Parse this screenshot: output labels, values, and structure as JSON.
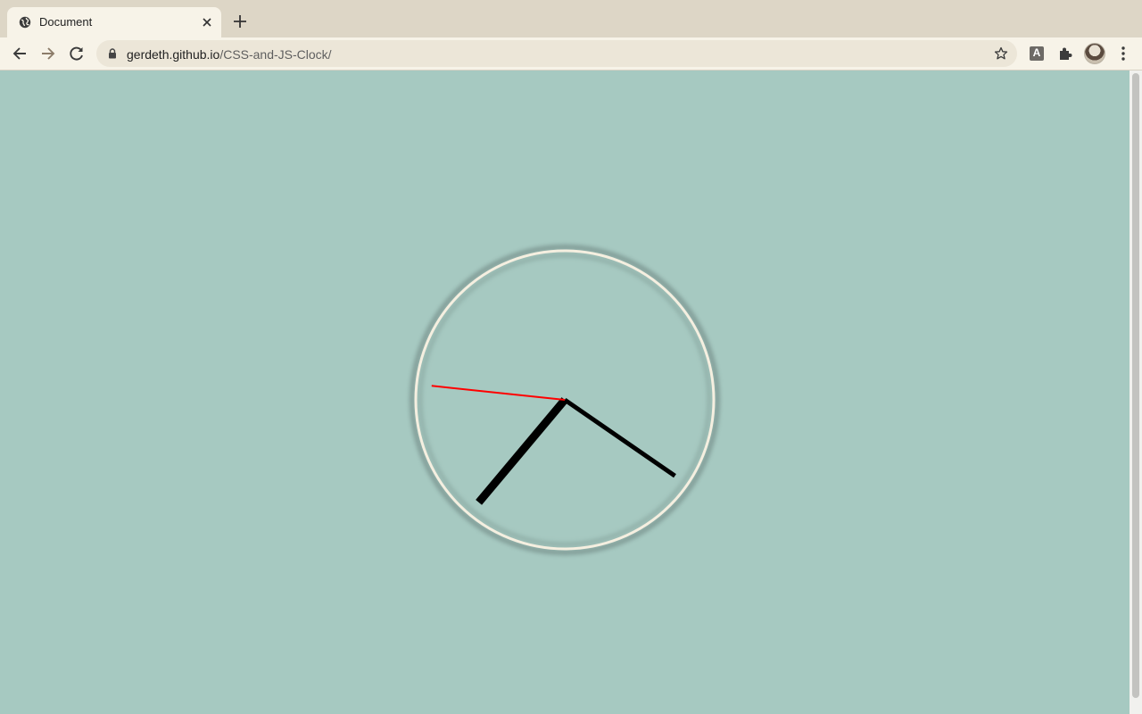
{
  "browser": {
    "tab": {
      "title": "Document"
    },
    "address_bar": {
      "host": "gerdeth.github.io",
      "path": "/CSS-and-JS-Clock/"
    },
    "extension_badge": "A"
  },
  "clock": {
    "time": {
      "hours": 7,
      "minutes": 20,
      "seconds": 46
    },
    "colors": {
      "background": "#a6c9c1",
      "face_border": "#f5efe0",
      "hour_hand": "#000000",
      "minute_hand": "#000000",
      "second_hand": "#ff0000"
    }
  }
}
